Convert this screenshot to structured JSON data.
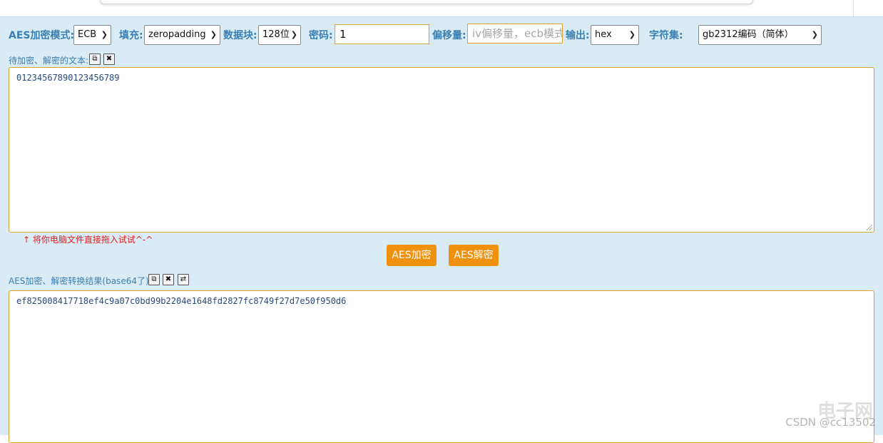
{
  "toolbar": {
    "mode_label": "AES加密模式:",
    "mode_value": "ECB",
    "padding_label": "填充:",
    "padding_value": "zeropadding",
    "block_label": "数据块:",
    "block_value": "128位",
    "password_label": "密码:",
    "password_value": "1",
    "offset_label": "偏移量:",
    "offset_placeholder": "iv偏移量，ecb模式不用填写",
    "output_label": "输出:",
    "output_value": "hex",
    "charset_label": "字符集:",
    "charset_value": "gb2312编码（简体）"
  },
  "input": {
    "label": "待加密、解密的文本:",
    "text": "01234567890123456789",
    "hint": "↑ 将你电脑文件直接拖入试试^-^"
  },
  "actions": {
    "encrypt_label": "AES加密",
    "decrypt_label": "AES解密"
  },
  "output": {
    "label": "AES加密、解密转换结果(base64了):",
    "text": "ef825008417718ef4c9a07c0bd99b2204e1648fd2827fc8749f27d7e50f950d6"
  },
  "icons": {
    "copy": "copy-icon",
    "clear": "clear-icon",
    "swap": "swap-icon",
    "chevron": "chevron-down-icon"
  },
  "watermark": {
    "text": "CSDN @cc13502",
    "logo": "电子网"
  },
  "colors": {
    "panel_bg": "#d9ecf5",
    "label_blue": "#3b7fb3",
    "accent_orange": "#f0900f",
    "field_border": "#e0a030",
    "hint_red": "#e02020"
  }
}
